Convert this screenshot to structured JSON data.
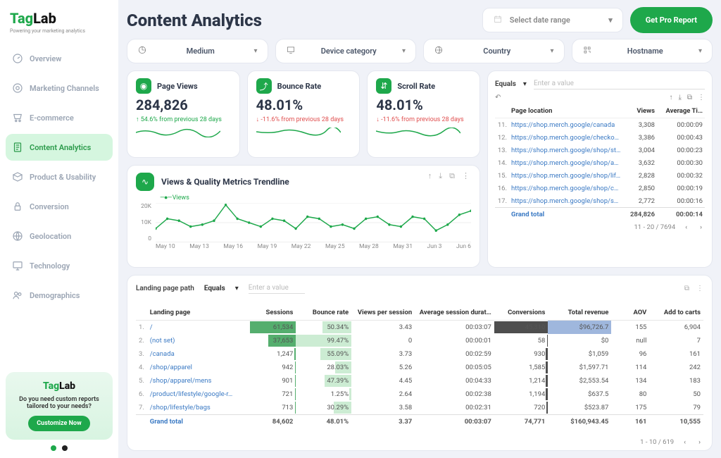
{
  "brand": {
    "name_a": "Tag",
    "name_b": "Lab",
    "tagline": "Powering your marketing analytics"
  },
  "sidebar": {
    "items": [
      {
        "label": "Overview"
      },
      {
        "label": "Marketing Channels"
      },
      {
        "label": "E-commerce"
      },
      {
        "label": "Content Analytics"
      },
      {
        "label": "Product & Usability"
      },
      {
        "label": "Conversion"
      },
      {
        "label": "Geolocation"
      },
      {
        "label": "Technology"
      },
      {
        "label": "Demographics"
      }
    ],
    "promo": {
      "text": "Do you need custom reports tailored to your needs?",
      "cta": "Customize Now"
    }
  },
  "page": {
    "title": "Content Analytics"
  },
  "date_picker": {
    "label": "Select date range"
  },
  "pro_button": "Get Pro Report",
  "filters": [
    {
      "label": "Medium"
    },
    {
      "label": "Device category"
    },
    {
      "label": "Country"
    },
    {
      "label": "Hostname"
    }
  ],
  "kpis": {
    "page_views": {
      "title": "Page Views",
      "value": "284,826",
      "delta": "54.6% from previous 28 days",
      "dir": "up"
    },
    "bounce_rate": {
      "title": "Bounce Rate",
      "value": "48.01%",
      "delta": "-11.6% from previous 28 days",
      "dir": "down"
    },
    "scroll_rate": {
      "title": "Scroll Rate",
      "value": "48.01%",
      "delta": "-11.6% from previous 28 days",
      "dir": "down"
    }
  },
  "right_table": {
    "operator": "Equals",
    "placeholder": "Enter a value",
    "headers": {
      "page": "Page location",
      "views": "Views",
      "time": "Average Ti…"
    },
    "rows": [
      {
        "n": "11.",
        "url": "https://shop.merch.google/canada",
        "views": "3,308",
        "time": "00:00:09"
      },
      {
        "n": "12.",
        "url": "https://shop.merch.google/checkout?s…",
        "views": "3,386",
        "time": "00:00:43"
      },
      {
        "n": "13.",
        "url": "https://shop.merch.google/shop/statio…",
        "views": "3,004",
        "time": "00:00:23"
      },
      {
        "n": "14.",
        "url": "https://shop.merch.google/shop/appar…",
        "views": "3,632",
        "time": "00:00:30"
      },
      {
        "n": "15.",
        "url": "https://shop.merch.google/shop/lifestyle",
        "views": "2,828",
        "time": "00:00:32"
      },
      {
        "n": "16.",
        "url": "https://shop.merch.google/shop/collec…",
        "views": "2,850",
        "time": "00:00:19"
      },
      {
        "n": "17.",
        "url": "https://shop.merch.google/shop/shop-…",
        "views": "2,772",
        "time": "00:00:16"
      }
    ],
    "total": {
      "label": "Grand total",
      "views": "284,826",
      "time": "00:00:14"
    },
    "pager": "11 - 20 / 7694"
  },
  "trend": {
    "title": "Views & Quality Metrics Trendline",
    "legend": "Views"
  },
  "chart_data": {
    "type": "line",
    "title": "Views & Quality Metrics Trendline",
    "series": [
      {
        "name": "Views",
        "values": [
          7000,
          12000,
          11000,
          8000,
          9000,
          11000,
          19000,
          12000,
          10000,
          8000,
          12000,
          11000,
          7000,
          13000,
          12000,
          8000,
          9000,
          7000,
          12000,
          13000,
          9000,
          8000,
          13000,
          12000,
          6000,
          9000,
          14000,
          16000
        ]
      }
    ],
    "x_labels": [
      "May 10",
      "May 13",
      "May 16",
      "May 19",
      "May 22",
      "May 25",
      "May 28",
      "May 31",
      "Jun 3",
      "Jun 6"
    ],
    "y_labels": [
      "20K",
      "10K",
      "0"
    ],
    "ylim": [
      0,
      20000
    ]
  },
  "landing_table": {
    "filter_label": "Landing page path",
    "operator": "Equals",
    "placeholder": "Enter a value",
    "headers": [
      "",
      "Landing page",
      "Sessions",
      "Bounce rate",
      "Views per session",
      "Average session durat…",
      "Conversions",
      "Total revenue",
      "AOV",
      "Add to carts"
    ],
    "rows": [
      {
        "n": "1.",
        "lp": "/",
        "sessions": "61,534",
        "sess_w": 85,
        "br": "50.34%",
        "br_w": 52,
        "vps": "3.43",
        "dur": "00:03:07",
        "conv": "45,310",
        "conv_w": 100,
        "rev": "$96,726.7",
        "rev_hl": true,
        "aov": "155",
        "cart": "6,904"
      },
      {
        "n": "2.",
        "lp": "(not set)",
        "sessions": "37,653",
        "sess_w": 52,
        "br": "99.47%",
        "br_w": 100,
        "vps": "0",
        "dur": "00:00:01",
        "conv": "58",
        "conv_w": 2,
        "rev": "$0",
        "aov": "null",
        "cart": "7"
      },
      {
        "n": "3.",
        "lp": "/canada",
        "sessions": "1,247",
        "sess_w": 3,
        "br": "55.09%",
        "br_w": 56,
        "vps": "3.73",
        "dur": "00:02:59",
        "conv": "930",
        "conv_w": 4,
        "rev": "$1,059",
        "aov": "96",
        "cart": "161"
      },
      {
        "n": "4.",
        "lp": "/shop/apparel",
        "sessions": "942",
        "sess_w": 2,
        "br": "28.03%",
        "br_w": 30,
        "vps": "5.26",
        "dur": "00:05:05",
        "conv": "1,585",
        "conv_w": 5,
        "rev": "$1,597.71",
        "aov": "114",
        "cart": "242"
      },
      {
        "n": "5.",
        "lp": "/shop/apparel/mens",
        "sessions": "901",
        "sess_w": 2,
        "br": "47.39%",
        "br_w": 49,
        "vps": "4.45",
        "dur": "00:04:33",
        "conv": "1,214",
        "conv_w": 4,
        "rev": "$2,553.54",
        "aov": "134",
        "cart": "183"
      },
      {
        "n": "6.",
        "lp": "/product/lifestyle/google-r…",
        "sessions": "721",
        "sess_w": 2,
        "br": "1.25%",
        "br_w": 4,
        "vps": "2.64",
        "dur": "00:02:38",
        "conv": "1,194",
        "conv_w": 4,
        "rev": "$637.5",
        "aov": "80",
        "cart": "50"
      },
      {
        "n": "7.",
        "lp": "/shop/lifestyle/bags",
        "sessions": "713",
        "sess_w": 2,
        "br": "30.29%",
        "br_w": 32,
        "vps": "3.58",
        "dur": "00:02:31",
        "conv": "720",
        "conv_w": 3,
        "rev": "$523.87",
        "aov": "175",
        "cart": "79"
      }
    ],
    "total": {
      "label": "Grand total",
      "sessions": "84,602",
      "br": "48.01%",
      "vps": "3.37",
      "dur": "00:03:07",
      "conv": "74,771",
      "rev": "$160,943.45",
      "aov": "161",
      "cart": "10,555"
    },
    "pager": "1 - 10 / 619"
  }
}
